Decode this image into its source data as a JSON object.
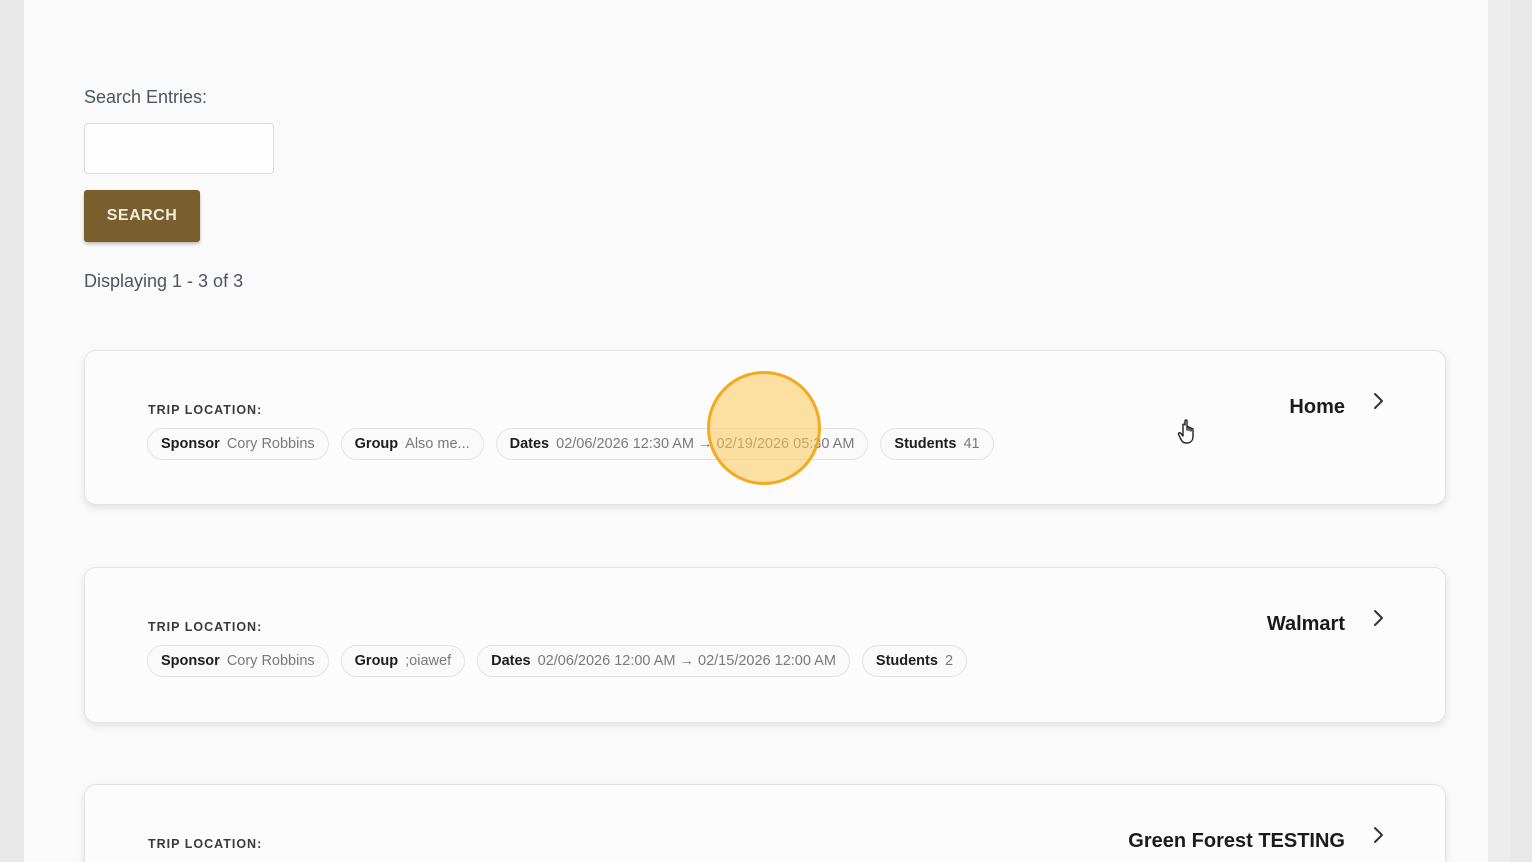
{
  "search": {
    "label": "Search Entries:",
    "placeholder": "",
    "value": "",
    "button_label": "SEARCH"
  },
  "results": {
    "summary": "Displaying 1 - 3 of 3"
  },
  "trips": [
    {
      "location_label": "TRIP LOCATION:",
      "name": "Home",
      "sponsor_key": "Sponsor",
      "sponsor": "Cory Robbins",
      "group_key": "Group",
      "group": "Also me...",
      "dates_key": "Dates",
      "dates": "02/06/2026 12:30 AM → 02/19/2026 05:30 AM",
      "students_key": "Students",
      "students": "41"
    },
    {
      "location_label": "TRIP LOCATION:",
      "name": "Walmart",
      "sponsor_key": "Sponsor",
      "sponsor": "Cory Robbins",
      "group_key": "Group",
      "group": ";oiawef",
      "dates_key": "Dates",
      "dates": "02/06/2026 12:00 AM → 02/15/2026 12:00 AM",
      "students_key": "Students",
      "students": "2"
    },
    {
      "location_label": "TRIP LOCATION:",
      "name": "Green Forest TESTING"
    }
  ],
  "icons": {
    "chevron": "chevron-right-icon",
    "cursor": "hand-pointer-icon"
  },
  "colors": {
    "button_bg": "#7a5f2e",
    "click_highlight": "#f5a91e"
  }
}
